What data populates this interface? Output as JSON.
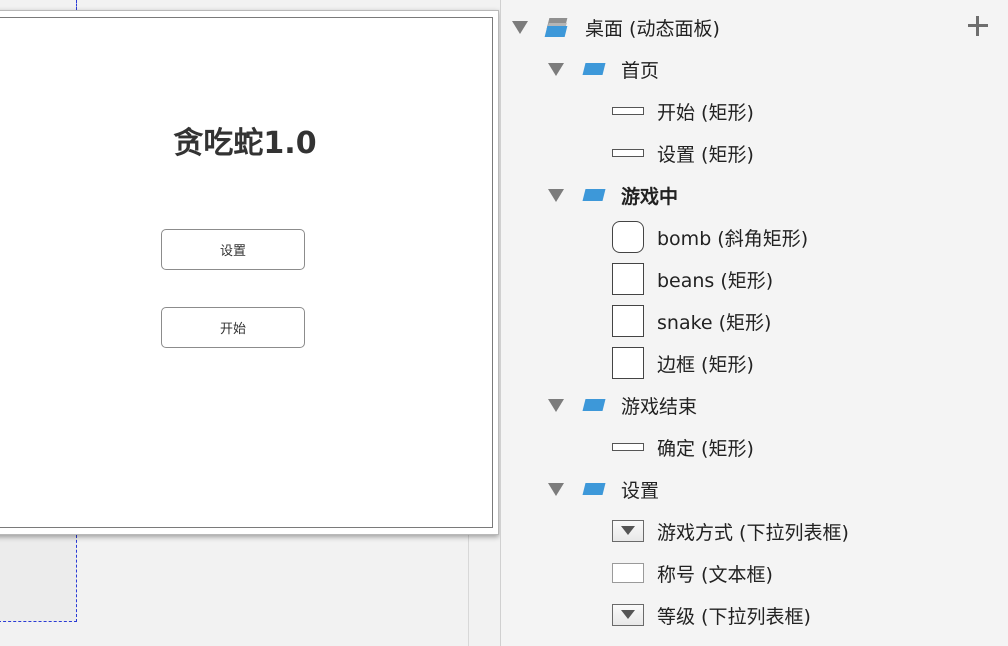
{
  "preview": {
    "title": "贪吃蛇1.0",
    "settings_button": "设置",
    "start_button": "开始"
  },
  "outline": {
    "root": {
      "label": "桌面 (动态面板)",
      "icon": "dynamic-panel-icon"
    },
    "add_icon": "plus-icon",
    "items": [
      {
        "label": "首页",
        "icon": "panel-state-icon",
        "level": 1,
        "bold": false
      },
      {
        "label": "开始 (矩形)",
        "icon": "flat-rectangle-icon",
        "level": 2
      },
      {
        "label": "设置 (矩形)",
        "icon": "flat-rectangle-icon",
        "level": 2
      },
      {
        "label": "游戏中",
        "icon": "panel-state-icon",
        "level": 1,
        "bold": true
      },
      {
        "label": "bomb (斜角矩形)",
        "icon": "rounded-rectangle-icon",
        "level": 2
      },
      {
        "label": "beans (矩形)",
        "icon": "rectangle-icon",
        "level": 2
      },
      {
        "label": "snake (矩形)",
        "icon": "rectangle-icon",
        "level": 2
      },
      {
        "label": "边框 (矩形)",
        "icon": "rectangle-icon",
        "level": 2
      },
      {
        "label": "游戏结束",
        "icon": "panel-state-icon",
        "level": 1,
        "bold": false
      },
      {
        "label": "确定 (矩形)",
        "icon": "flat-rectangle-icon",
        "level": 2
      },
      {
        "label": "设置",
        "icon": "panel-state-icon",
        "level": 1,
        "bold": false
      },
      {
        "label": "游戏方式 (下拉列表框)",
        "icon": "dropdown-icon",
        "level": 2
      },
      {
        "label": "称号 (文本框)",
        "icon": "textbox-icon",
        "level": 2
      },
      {
        "label": "等级 (下拉列表框)",
        "icon": "dropdown-icon",
        "level": 2
      }
    ]
  },
  "colors": {
    "accent": "#3d98d9",
    "guide": "#2a3bd6"
  }
}
